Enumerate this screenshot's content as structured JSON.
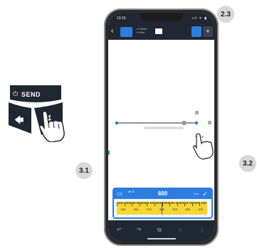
{
  "badges": {
    "step_2_3": "2.3",
    "step_3_1": "3.1",
    "step_3_2": "3.2"
  },
  "device_pad": {
    "send_label": "SEND",
    "power_icon": "power-icon",
    "left_icon": "arrow-left-icon",
    "down_icon": "arrow-down-icon"
  },
  "phone": {
    "status_time": "13:15",
    "status_icons": "ııl ᯤ ▮",
    "appbar": {
      "back_label": "‹",
      "measure_text_1": "0.000m²",
      "measure_text_2": "0.00m"
    },
    "panel": {
      "label": "alt ①",
      "value": "600",
      "unit": "mm",
      "ruler_numbers": [
        "525",
        "550",
        "575",
        "600",
        "625",
        "650",
        "675"
      ]
    },
    "bottom_icons": [
      "↶",
      "↷",
      "⧉",
      "⁙",
      "⋮"
    ]
  },
  "colors": {
    "accent": "#2d7de0",
    "ruler": "#f5d532",
    "appbar": "#1f2732"
  }
}
